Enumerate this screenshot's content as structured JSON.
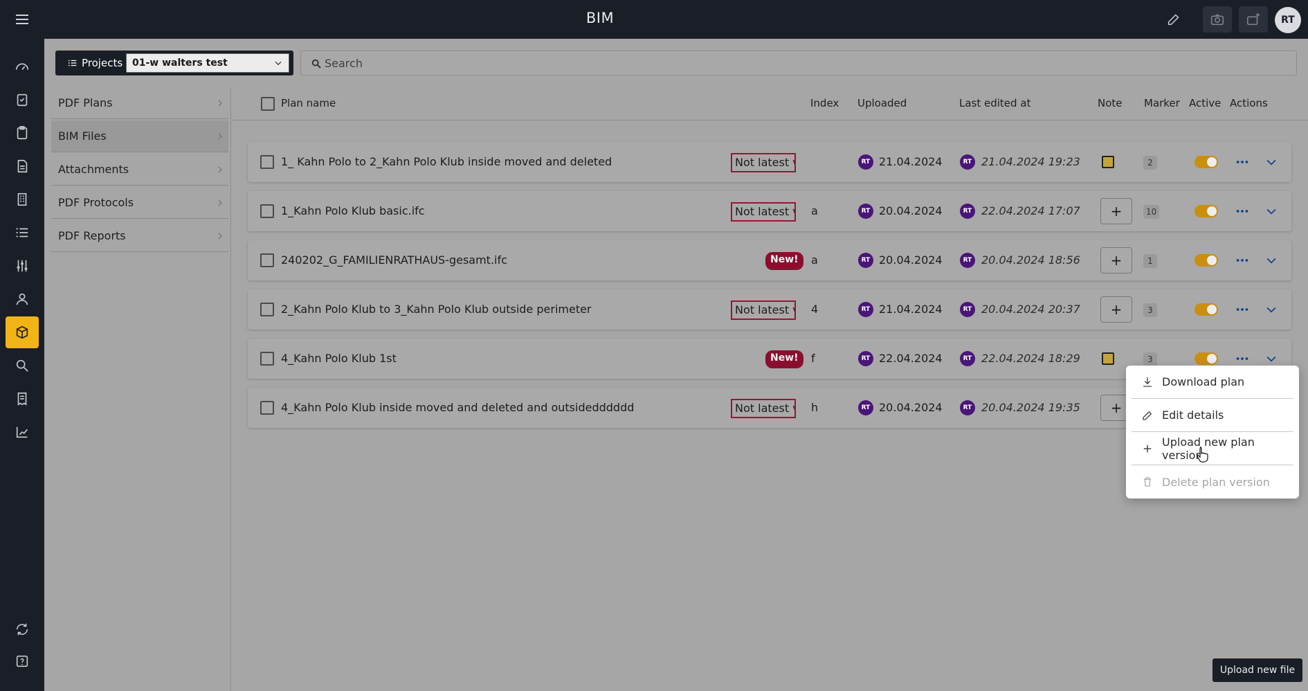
{
  "app": {
    "title": "BIM",
    "avatar": "RT"
  },
  "project_bar": {
    "label": "Projects",
    "selected": "01-w walters test"
  },
  "search": {
    "placeholder": "Search"
  },
  "side_nav": {
    "items": [
      {
        "label": "PDF Plans"
      },
      {
        "label": "BIM Files"
      },
      {
        "label": "Attachments"
      },
      {
        "label": "PDF Protocols"
      },
      {
        "label": "PDF Reports"
      }
    ],
    "selected": "BIM Files"
  },
  "table": {
    "headers": {
      "plan_name": "Plan name",
      "index": "Index",
      "uploaded": "Uploaded",
      "last_edited": "Last edited at",
      "note": "Note",
      "marker": "Marker",
      "active": "Active",
      "actions": "Actions"
    },
    "rows": [
      {
        "name": "1_ Kahn Polo to 2_Kahn Polo Klub inside moved and deleted",
        "badge": "Not latest version",
        "badge_type": "old",
        "index": "",
        "uploader": "RT",
        "uploaded": "21.04.2024",
        "editor": "RT",
        "edited": "21.04.2024 19:23",
        "note": "note",
        "marker": "2",
        "active": true
      },
      {
        "name": "1_Kahn Polo Klub basic.ifc",
        "badge": "Not latest version",
        "badge_type": "old",
        "index": "a",
        "uploader": "RT",
        "uploaded": "20.04.2024",
        "editor": "RT",
        "edited": "22.04.2024 17:07",
        "note": "add",
        "marker": "10",
        "active": true
      },
      {
        "name": "240202_G_FAMILIENRATHAUS-gesamt.ifc",
        "badge": "New!",
        "badge_type": "new",
        "index": "a",
        "uploader": "RT",
        "uploaded": "20.04.2024",
        "editor": "RT",
        "edited": "20.04.2024 18:56",
        "note": "add",
        "marker": "1",
        "active": true
      },
      {
        "name": "2_Kahn Polo Klub to 3_Kahn Polo Klub outside perimeter",
        "badge": "Not latest version",
        "badge_type": "old",
        "index": "4",
        "uploader": "RT",
        "uploaded": "21.04.2024",
        "editor": "RT",
        "edited": "20.04.2024 20:37",
        "note": "add",
        "marker": "3",
        "active": true
      },
      {
        "name": "4_Kahn Polo Klub 1st",
        "badge": "New!",
        "badge_type": "new",
        "index": "f",
        "uploader": "RT",
        "uploaded": "22.04.2024",
        "editor": "RT",
        "edited": "22.04.2024 18:29",
        "note": "note",
        "marker": "3",
        "active": true
      },
      {
        "name": "4_Kahn Polo Klub inside moved and deleted and outsidedddddd",
        "badge": "Not latest version",
        "badge_type": "old",
        "index": "h",
        "uploader": "RT",
        "uploaded": "20.04.2024",
        "editor": "RT",
        "edited": "20.04.2024 19:35",
        "note": "add",
        "marker": "",
        "active": true
      }
    ]
  },
  "context_menu": {
    "items": [
      {
        "label": "Download plan",
        "icon": "download-icon",
        "disabled": false
      },
      {
        "label": "Edit details",
        "icon": "pencil-icon",
        "disabled": false
      },
      {
        "label": "Upload new plan version",
        "icon": "plus-icon",
        "disabled": false
      },
      {
        "label": "Delete plan version",
        "icon": "trash-icon",
        "disabled": true
      }
    ]
  },
  "upload_button": {
    "label": "Upload new file"
  },
  "colors": {
    "accent": "#f0b417",
    "topbar": "#1a1e26",
    "badge": "#8a0f2e",
    "avatar": "#4a1578"
  }
}
